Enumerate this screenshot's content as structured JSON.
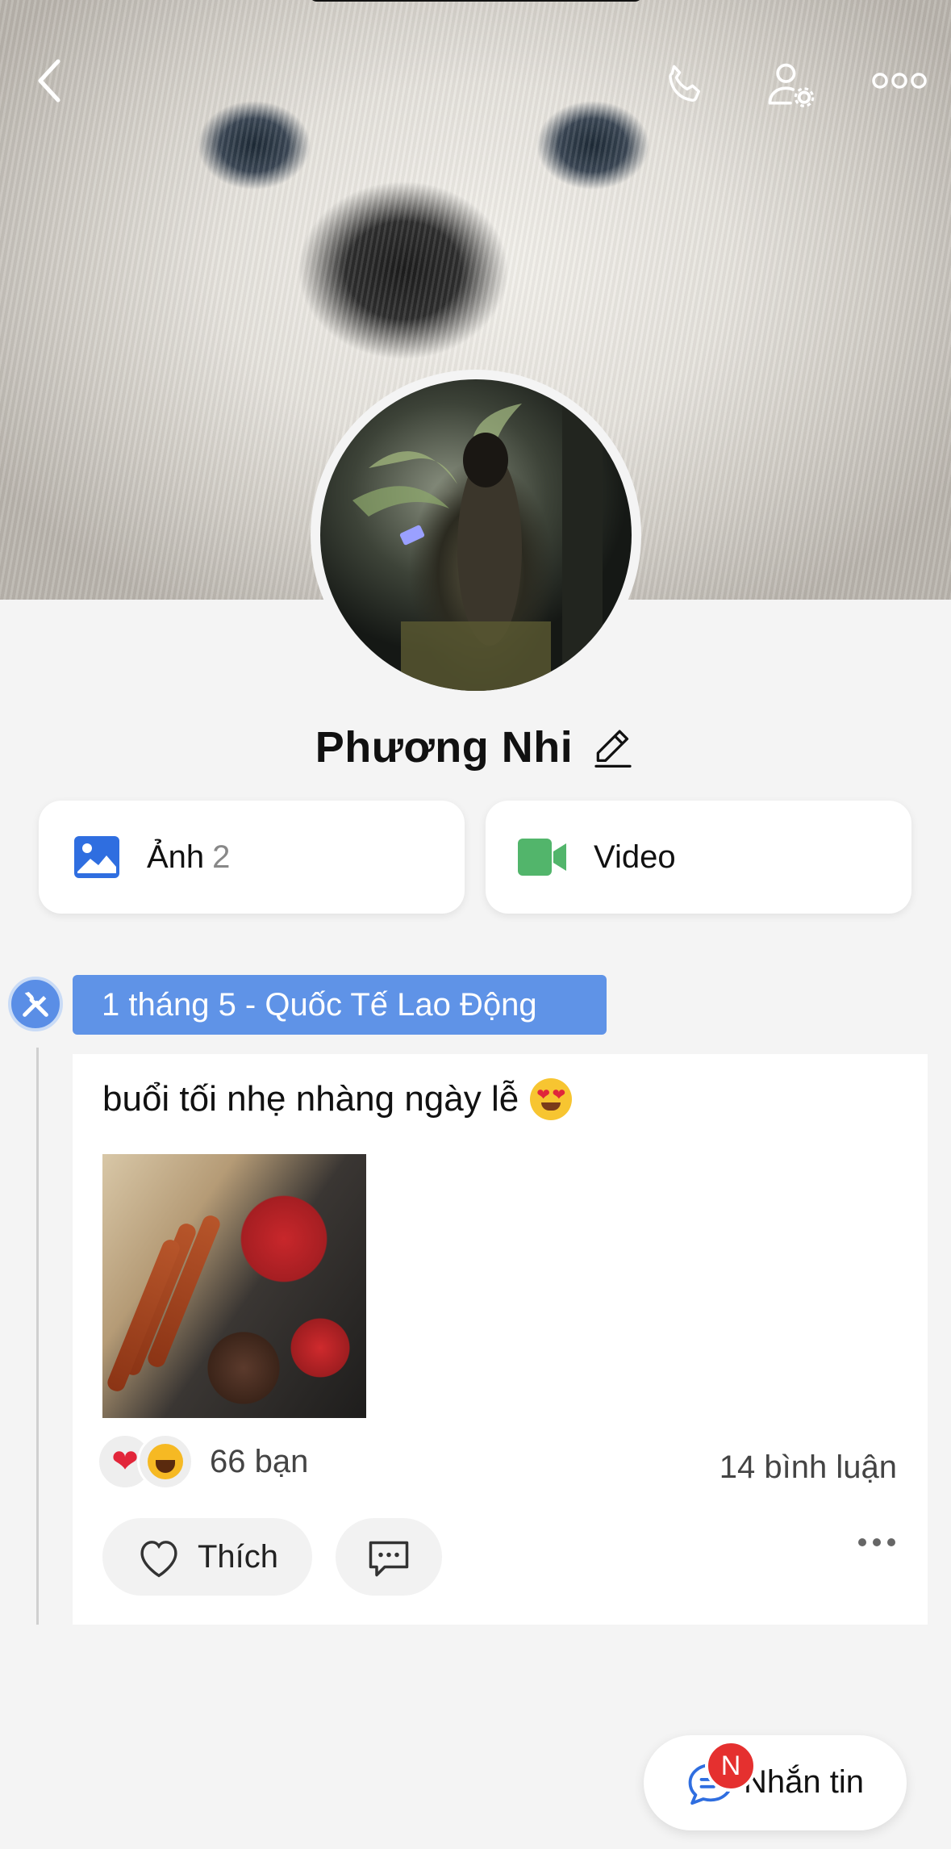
{
  "header": {
    "back_icon": "chevron-left-icon",
    "call_icon": "phone-icon",
    "settings_icon": "user-gear-icon",
    "more_icon": "more-dots-icon"
  },
  "profile": {
    "name": "Phương Nhi",
    "edit_icon": "pencil-icon"
  },
  "media": {
    "photos": {
      "label": "Ảnh",
      "count": "2",
      "icon": "image-icon",
      "color": "#2f6ee0"
    },
    "videos": {
      "label": "Video",
      "icon": "video-camera-icon",
      "color": "#52b56b"
    }
  },
  "timeline": {
    "tag_icon": "tools-icon",
    "tag_label": "1 tháng 5 - Quốc Tế Lao Động",
    "tag_color": "#5f93e7"
  },
  "post": {
    "text": "buổi tối nhẹ nhàng ngày lễ",
    "emoji": "heart-eyes-emoji",
    "reactions": [
      "heart",
      "haha"
    ],
    "reaction_count": "66 bạn",
    "comment_count": "14 bình luận",
    "like_label": "Thích",
    "comment_icon": "comment-icon",
    "more_icon": "more-dots-icon"
  },
  "fab": {
    "label": "Nhắn tin",
    "badge": "N",
    "icon": "chat-bubble-icon",
    "badge_color": "#e5302f"
  }
}
